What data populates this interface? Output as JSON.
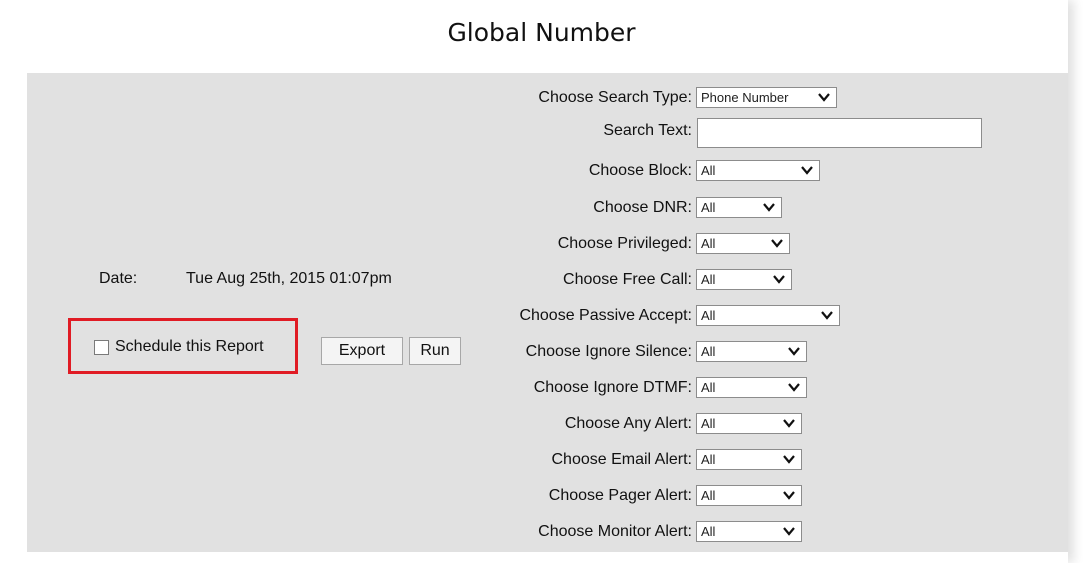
{
  "title": "Global Number",
  "report": {
    "date_label": "Date:",
    "date_value": "Tue Aug 25th, 2015 01:07pm",
    "schedule_label": "Schedule this Report",
    "schedule_checked": false,
    "export_label": "Export",
    "run_label": "Run"
  },
  "filters": [
    {
      "label": "Choose Search Type:",
      "value": "Phone Number",
      "kind": "select"
    },
    {
      "label": "Search Text:",
      "value": "",
      "kind": "text"
    },
    {
      "label": "Choose Block:",
      "value": "All",
      "kind": "select"
    },
    {
      "label": "Choose DNR:",
      "value": "All",
      "kind": "select"
    },
    {
      "label": "Choose Privileged:",
      "value": "All",
      "kind": "select"
    },
    {
      "label": "Choose Free Call:",
      "value": "All",
      "kind": "select"
    },
    {
      "label": "Choose Passive Accept:",
      "value": "All",
      "kind": "select"
    },
    {
      "label": "Choose Ignore Silence:",
      "value": "All",
      "kind": "select"
    },
    {
      "label": "Choose Ignore DTMF:",
      "value": "All",
      "kind": "select"
    },
    {
      "label": "Choose Any Alert:",
      "value": "All",
      "kind": "select"
    },
    {
      "label": "Choose Email Alert:",
      "value": "All",
      "kind": "select"
    },
    {
      "label": "Choose Pager Alert:",
      "value": "All",
      "kind": "select"
    },
    {
      "label": "Choose Monitor Alert:",
      "value": "All",
      "kind": "select"
    }
  ],
  "colors": {
    "panel": "#e1e1e1",
    "highlight": "#e01b24"
  }
}
